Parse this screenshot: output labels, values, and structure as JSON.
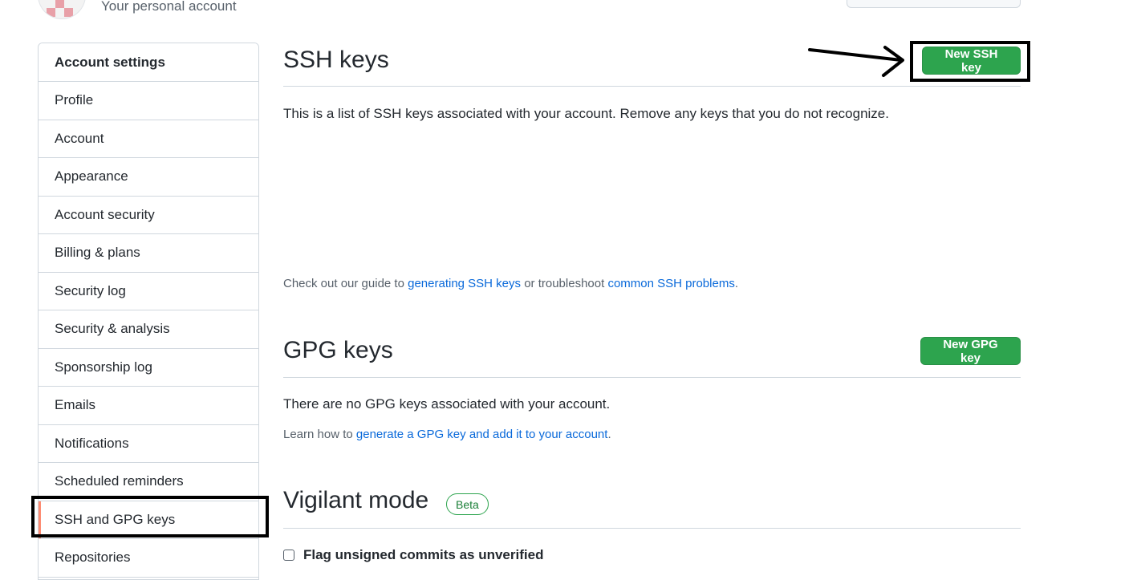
{
  "header": {
    "subtitle": "Your personal account"
  },
  "sidebar": {
    "header": "Account settings",
    "items": [
      {
        "label": "Profile"
      },
      {
        "label": "Account"
      },
      {
        "label": "Appearance"
      },
      {
        "label": "Account security"
      },
      {
        "label": "Billing & plans"
      },
      {
        "label": "Security log"
      },
      {
        "label": "Security & analysis"
      },
      {
        "label": "Sponsorship log"
      },
      {
        "label": "Emails"
      },
      {
        "label": "Notifications"
      },
      {
        "label": "Scheduled reminders"
      },
      {
        "label": "SSH and GPG keys",
        "selected": true
      },
      {
        "label": "Repositories"
      }
    ]
  },
  "ssh": {
    "title": "SSH keys",
    "button": "New SSH key",
    "description": "This is a list of SSH keys associated with your account. Remove any keys that you do not recognize.",
    "guide_prefix": "Check out our guide to ",
    "guide_link1": "generating SSH keys",
    "guide_middle": " or troubleshoot ",
    "guide_link2": "common SSH problems",
    "guide_suffix": "."
  },
  "gpg": {
    "title": "GPG keys",
    "button": "New GPG key",
    "empty_text": "There are no GPG keys associated with your account.",
    "learn_prefix": "Learn how to ",
    "learn_link": "generate a GPG key and add it to your account",
    "learn_suffix": "."
  },
  "vigilant": {
    "title": "Vigilant mode",
    "badge": "Beta",
    "checkbox_label": "Flag unsigned commits as unverified"
  },
  "colors": {
    "accent_green": "#2da44e",
    "link_blue": "#0969da",
    "selected_marker": "#fd8c73"
  }
}
